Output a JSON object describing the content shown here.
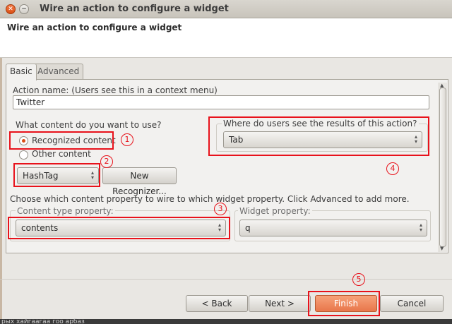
{
  "window": {
    "title": "Wire an action to configure a widget"
  },
  "banner": {
    "title": "Wire an action to configure a widget"
  },
  "tabs": [
    {
      "label": "Basic"
    },
    {
      "label": "Advanced"
    }
  ],
  "action_name": {
    "label": "Action name: (Users see this in a context menu)",
    "value": "Twitter"
  },
  "content": {
    "question": "What content do you want to use?",
    "options": [
      {
        "label": "Recognized content",
        "selected": true
      },
      {
        "label": "Other content",
        "selected": false
      }
    ],
    "recognizer": {
      "value": "HashTag"
    },
    "new_recognizer_label": "New Recognizer..."
  },
  "results": {
    "legend": "Where do users see the results of this action?",
    "value": "Tab"
  },
  "wire": {
    "instruction": "Choose which content property to wire to which widget property. Click Advanced to add more.",
    "content_type_legend": "Content type property:",
    "content_type_value": "contents",
    "widget_legend": "Widget property:",
    "widget_value": "q"
  },
  "buttons": {
    "back": "< Back",
    "next": "Next >",
    "finish": "Finish",
    "cancel": "Cancel"
  },
  "annotations": [
    "1",
    "2",
    "3",
    "4",
    "5"
  ],
  "background_text": "рых хайгаагаа гоо арбаз",
  "colors": {
    "annotation": "#e8121b",
    "finish": "#e8764a",
    "radio_selected": "#d94e14"
  }
}
